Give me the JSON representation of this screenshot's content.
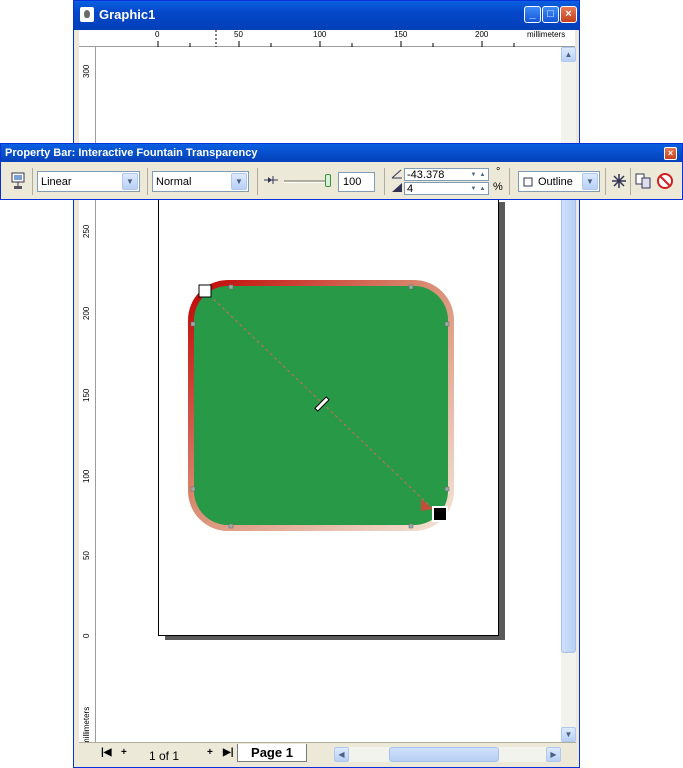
{
  "window": {
    "title": "Graphic1",
    "minimize_label": "_",
    "maximize_label": "□",
    "close_label": "×"
  },
  "rulers": {
    "units": "millimeters",
    "horizontal_ticks": [
      "0",
      "50",
      "100",
      "150",
      "200"
    ],
    "vertical_ticks": [
      "300",
      "250",
      "200",
      "150",
      "100",
      "50",
      "0"
    ]
  },
  "property_bar": {
    "title": "Property Bar: Interactive Fountain Transparency",
    "close_label": "×",
    "transparency_type": "Linear",
    "merge_mode": "Normal",
    "midpoint_value": "100",
    "angle_value": "-43.378",
    "angle_unit": "°",
    "edge_pad_value": "4",
    "edge_pad_unit": "%",
    "target": "Outline",
    "slider_fraction": 1.0
  },
  "navigator": {
    "page_count": "1 of 1",
    "page_tab": "Page 1"
  },
  "colors": {
    "titlebar": "#0a5fe0",
    "shape_fill": "#289946",
    "shape_outline_dark": "#c00000",
    "shape_outline_light": "#e8c7a8",
    "workspace": "#ece9d8"
  }
}
